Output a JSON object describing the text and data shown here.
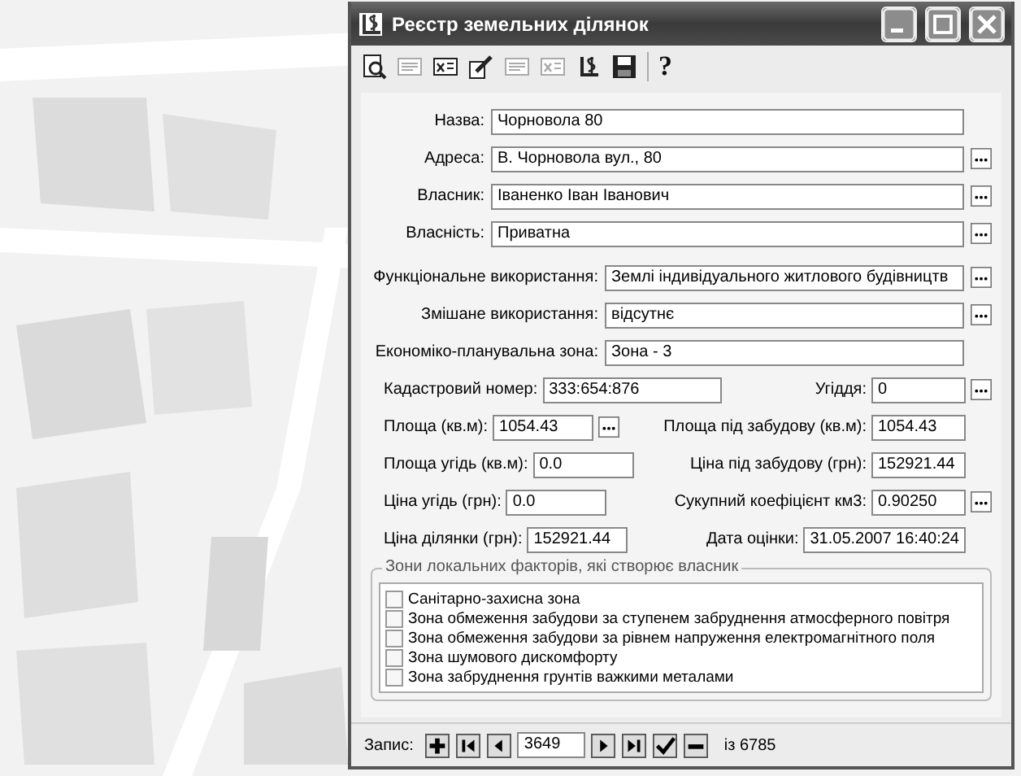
{
  "window": {
    "title": "Реєстр земельних ділянок"
  },
  "toolbar": [
    {
      "kind": "find",
      "disabled": false
    },
    {
      "kind": "doc",
      "disabled": true
    },
    {
      "kind": "docx",
      "disabled": false
    },
    {
      "kind": "pen",
      "disabled": false
    },
    {
      "kind": "doc",
      "disabled": true
    },
    {
      "kind": "docx",
      "disabled": true
    },
    {
      "kind": "ledger",
      "disabled": false
    },
    {
      "kind": "save",
      "disabled": false
    },
    {
      "kind": "help",
      "text": "?",
      "disabled": false
    }
  ],
  "main_fields": [
    {
      "label": "Назва:",
      "value": "Чорновола 80",
      "has_button": false
    },
    {
      "label": "Адреса:",
      "value": "В. Чорновола вул., 80",
      "has_button": true
    },
    {
      "label": "Власник:",
      "value": "Іваненко Іван Іванович",
      "has_button": true
    },
    {
      "label": "Власність:",
      "value": "Приватна",
      "has_button": true
    }
  ],
  "usage_fields": [
    {
      "label": "Функціональне використання:",
      "value": "Землі індивідуального житлового будівництв",
      "has_button": true
    },
    {
      "label": "Змішане використання:",
      "value": "відсутнє",
      "has_button": true
    },
    {
      "label": "Економіко-планувальна зона:",
      "value": "Зона - 3",
      "has_button": false
    }
  ],
  "pair_rows": [
    [
      {
        "label": "Кадастровий номер:",
        "value": "333:654:876",
        "has_button": false
      },
      {
        "label": "Угіддя:",
        "value": "0",
        "has_button": true
      }
    ],
    [
      {
        "label": "Площа (кв.м):",
        "value": "1054.43",
        "has_button": true
      },
      {
        "label": "Площа під забудову (кв.м):",
        "value": "1054.43",
        "has_button": false
      }
    ],
    [
      {
        "label": "Площа угідь (кв.м):",
        "value": "0.0",
        "has_button": false
      },
      {
        "label": "Ціна під забудову (грн):",
        "value": "152921.44",
        "has_button": false
      }
    ],
    [
      {
        "label": "Ціна угідь (грн):",
        "value": "0.0",
        "has_button": false
      },
      {
        "label": "Сукупний коефіцієнт км3:",
        "value": "0.90250",
        "has_button": true
      }
    ],
    [
      {
        "label": "Ціна ділянки (грн):",
        "value": "152921.44",
        "has_button": false
      },
      {
        "label": "Дата оцінки:",
        "value": "31.05.2007 16:40:24",
        "has_button": false
      }
    ]
  ],
  "zones": {
    "legend": "Зони локальних факторів, які створює власник",
    "items": [
      {
        "label": "Санітарно-захисна зона",
        "checked": false
      },
      {
        "label": "Зона обмеження забудови за ступенем забруднення  атмосферного повітря",
        "checked": false
      },
      {
        "label": "Зона обмеження забудови за рівнем напруження  електромагнітного поля",
        "checked": false
      },
      {
        "label": "Зона шумового дискомфорту",
        "checked": false
      },
      {
        "label": "Зона забруднення грунтів важкими металами",
        "checked": false
      }
    ]
  },
  "navigator": {
    "label": "Запис:",
    "record": "3649",
    "total": "із 6785",
    "buttons_before": [
      {
        "kind": "add"
      },
      {
        "kind": "first"
      },
      {
        "kind": "prev"
      }
    ],
    "buttons_after": [
      {
        "kind": "next"
      },
      {
        "kind": "last"
      },
      {
        "kind": "confirm"
      },
      {
        "kind": "delete"
      }
    ]
  }
}
